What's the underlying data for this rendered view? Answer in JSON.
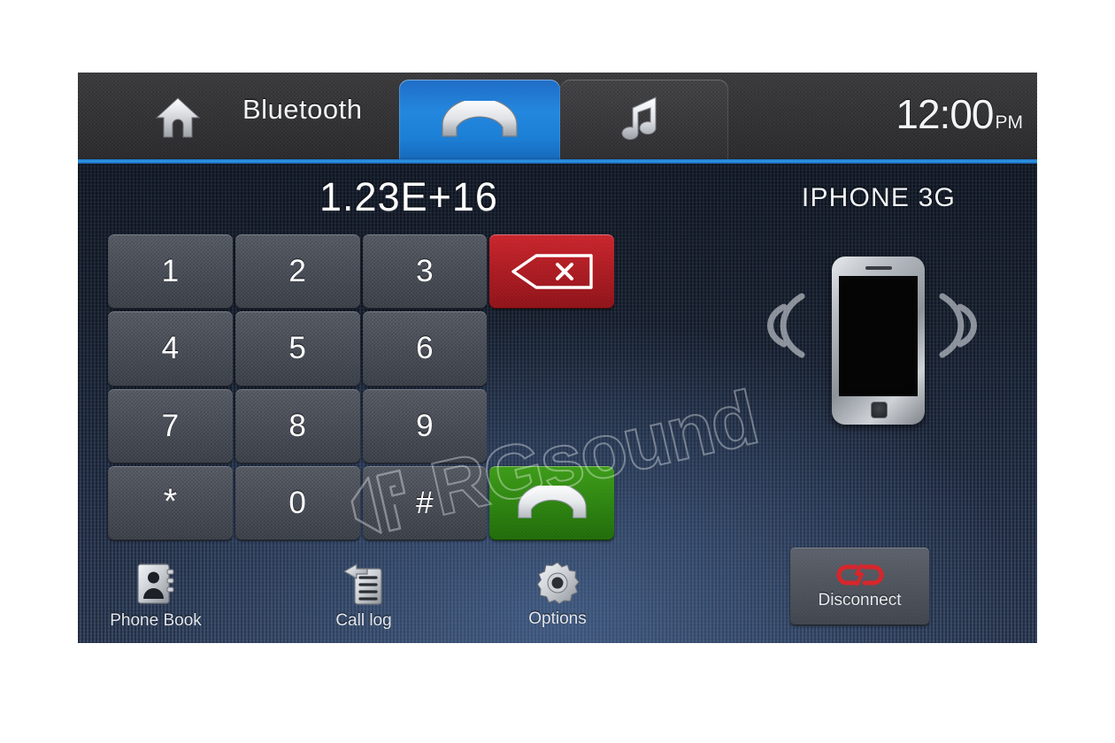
{
  "header": {
    "home_icon": "home-icon",
    "title": "Bluetooth",
    "tabs": [
      {
        "id": "phone",
        "icon": "phone-handset-icon",
        "active": true
      },
      {
        "id": "music",
        "icon": "music-note-icon",
        "active": false
      }
    ],
    "clock": {
      "time": "12:00",
      "meridiem": "PM"
    }
  },
  "main": {
    "dialed_number": "1.23E+16",
    "device_name": "IPHONE 3G",
    "keypad": [
      {
        "label": "1",
        "name": "key-1",
        "style": "grey"
      },
      {
        "label": "2",
        "name": "key-2",
        "style": "grey"
      },
      {
        "label": "3",
        "name": "key-3",
        "style": "grey"
      },
      {
        "label": "",
        "name": "backspace-button",
        "style": "red",
        "icon": "backspace-icon"
      },
      {
        "label": "4",
        "name": "key-4",
        "style": "grey"
      },
      {
        "label": "5",
        "name": "key-5",
        "style": "grey"
      },
      {
        "label": "6",
        "name": "key-6",
        "style": "grey"
      },
      {
        "label": "",
        "name": "keypad-spacer-1",
        "style": "none"
      },
      {
        "label": "7",
        "name": "key-7",
        "style": "grey"
      },
      {
        "label": "8",
        "name": "key-8",
        "style": "grey"
      },
      {
        "label": "9",
        "name": "key-9",
        "style": "grey"
      },
      {
        "label": "",
        "name": "keypad-spacer-2",
        "style": "none"
      },
      {
        "label": "*",
        "name": "key-star",
        "style": "grey"
      },
      {
        "label": "0",
        "name": "key-0",
        "style": "grey"
      },
      {
        "label": "#",
        "name": "key-hash",
        "style": "grey"
      },
      {
        "label": "",
        "name": "call-button",
        "style": "green",
        "icon": "phone-handset-icon"
      }
    ],
    "disconnect": {
      "label": "Disconnect",
      "icon": "broken-link-icon"
    }
  },
  "bottom_bar": [
    {
      "label": "Phone Book",
      "icon": "contacts-book-icon"
    },
    {
      "label": "Call log",
      "icon": "call-log-icon"
    },
    {
      "label": "Options",
      "icon": "gear-icon"
    }
  ],
  "watermark": {
    "text": "RGsound"
  },
  "colors": {
    "accent_blue": "#2487de",
    "call_green": "#2e8610",
    "delete_red": "#ae1b22",
    "disconnect_red": "#d7262b",
    "text_white": "#ffffff",
    "screen_bg": "#27324a",
    "header_bg": "#343436"
  }
}
